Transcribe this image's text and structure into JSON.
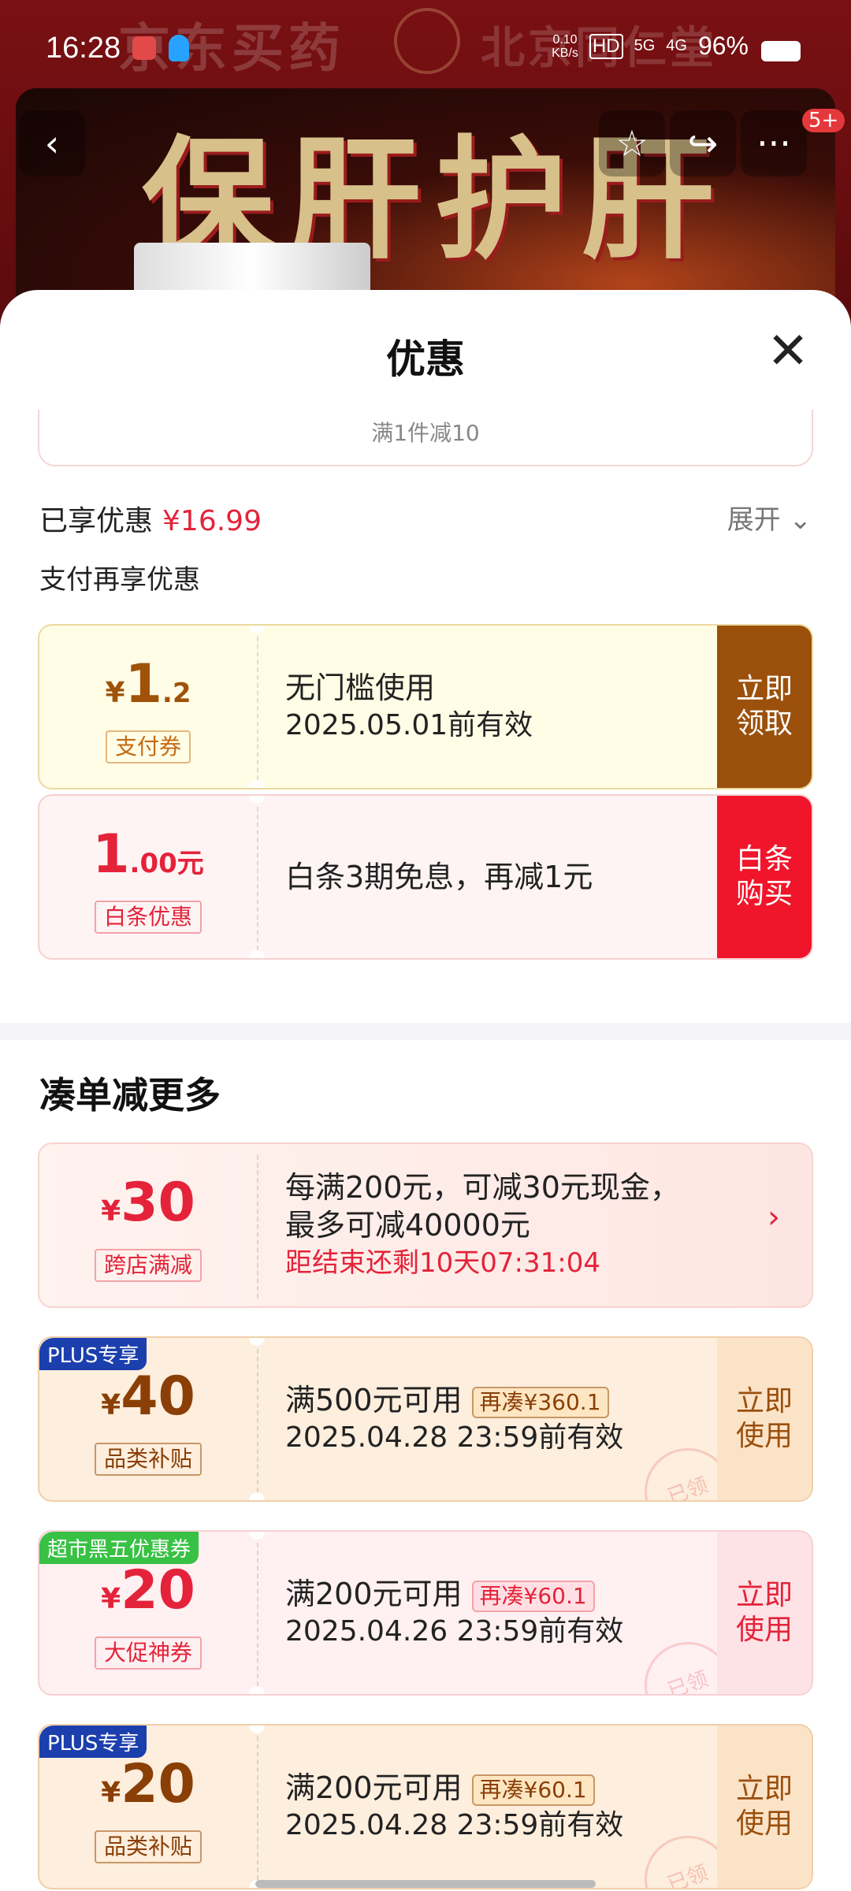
{
  "status_bar": {
    "time": "16:28",
    "net_speed_value": "0.10",
    "net_speed_unit": "KB/s",
    "hd": "HD",
    "net_5g": "5G",
    "net_4g": "4G",
    "battery": "96%"
  },
  "background": {
    "brand_text": "京东买药",
    "brand_text_2": "北京同仁堂",
    "banner_text": "保肝护肝"
  },
  "nav": {
    "back_icon": "‹",
    "star_icon": "☆",
    "share_icon": "↪",
    "more_icon": "···",
    "badge": "5+"
  },
  "sheet": {
    "title": "优惠",
    "close_icon": "✕",
    "prev_coupon_text": "满1件减10",
    "enjoyed_label": "已享优惠",
    "enjoyed_amount": "¥16.99",
    "expand_label": "展开",
    "expand_icon": "⌄",
    "pay_more_label": "支付再享优惠"
  },
  "pay_coupons": [
    {
      "currency": "¥",
      "amount": "1",
      "decimal": ".2",
      "unit": "",
      "tag": "支付券",
      "title": "无门槛使用",
      "date": "2025.05.01前有效",
      "action": "立即\n领取"
    },
    {
      "currency": "",
      "amount": "1",
      "decimal": ".00",
      "unit": "元",
      "tag": "白条优惠",
      "title": "白条3期免息，再减1元",
      "action": "白条\n购买"
    }
  ],
  "section_title": "凑单减更多",
  "cross_store": {
    "currency": "¥",
    "amount": "30",
    "tag": "跨店满减",
    "line1": "每满200元，可减30元现金，",
    "line2": "最多可减40000元",
    "countdown": "距结束还剩10天07:31:04",
    "chevron": "›"
  },
  "coupons": [
    {
      "corner": "PLUS专享",
      "currency": "¥",
      "amount": "40",
      "tag": "品类补贴",
      "title": "满500元可用",
      "pill": "再凑¥360.1",
      "date": "2025.04.28 23:59前有效",
      "action": "立即\n使用",
      "stamp": "已领"
    },
    {
      "corner": "超市黑五优惠券",
      "currency": "¥",
      "amount": "20",
      "tag": "大促神券",
      "title": "满200元可用",
      "pill": "再凑¥60.1",
      "date": "2025.04.26 23:59前有效",
      "action": "立即\n使用",
      "stamp": "已领"
    },
    {
      "corner": "PLUS专享",
      "currency": "¥",
      "amount": "20",
      "tag": "品类补贴",
      "title": "满200元可用",
      "pill": "再凑¥60.1",
      "date": "2025.04.28 23:59前有效",
      "action": "立即\n使用",
      "stamp": "已领"
    }
  ],
  "colors": {
    "brand_red": "#e4233a",
    "pay_button": "#9b500b",
    "baitiao_button": "#f0152b",
    "plus_badge": "#1c3fae",
    "market_badge": "#38c144"
  }
}
